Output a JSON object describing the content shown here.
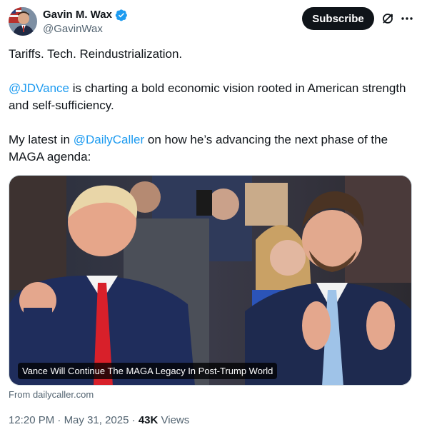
{
  "author": {
    "name": "Gavin M. Wax",
    "handle": "@GavinWax",
    "verified": true,
    "avatar_icon": "user-avatar"
  },
  "actions": {
    "subscribe_label": "Subscribe",
    "grok_icon": "grok-icon",
    "more_icon": "more-options-icon"
  },
  "tweet": {
    "line1": "Tariffs. Tech. Reindustrialization.",
    "p2_mention": "@JDVance",
    "p2_rest": " is charting a bold economic vision rooted in American strength and self-sufficiency.",
    "p3_pre": "My latest in ",
    "p3_mention": "@DailyCaller",
    "p3_rest": " on how he’s advancing the next phase of the MAGA agenda:"
  },
  "card": {
    "headline": "Vance Will Continue The MAGA Legacy In Post-Trump World",
    "source": "From dailycaller.com"
  },
  "meta": {
    "time": "12:20 PM",
    "separator": " · ",
    "date": "May 31, 2025",
    "views_count": "43K",
    "views_label": " Views"
  },
  "colors": {
    "link": "#1d9bf0",
    "text": "#0f1419",
    "secondary": "#536471",
    "verified": "#1d9bf0"
  }
}
